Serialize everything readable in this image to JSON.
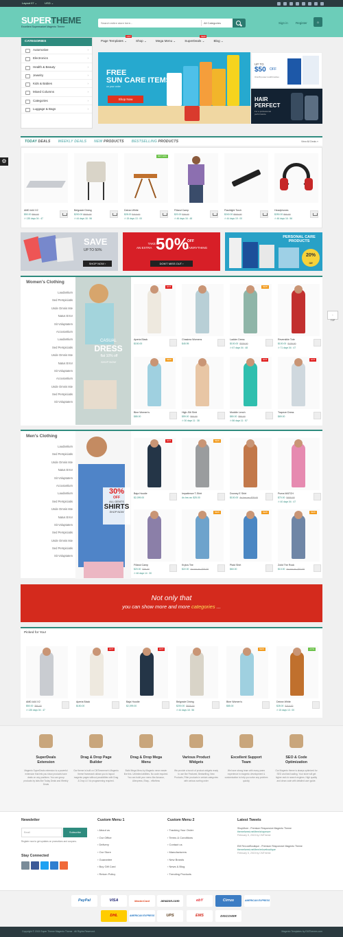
{
  "topbar": {
    "layout": "Layout 07 ⌄",
    "currency": "USD ⌄"
  },
  "header": {
    "logo_a": "SUPER",
    "logo_b": "THEME",
    "tagline": "Excellent Supermarket Magento Theme",
    "search_placeholder": "Search entire store here...",
    "search_category": "All Categories",
    "signin": "Sign in",
    "register": "Register",
    "cart_count": "0"
  },
  "categories": {
    "title": "CATEGORIES",
    "items": [
      "Automotive",
      "Electronics",
      "Health & Beauty",
      "Jewelry",
      "Kids & Babies",
      "Mixed Columns",
      "Categories",
      "Luggage & Bags"
    ]
  },
  "menu": {
    "items": [
      "Page Templates",
      "Shop",
      "Mega Menu",
      "SuperDeals",
      "Blog"
    ],
    "hot": "HOT",
    "new": "NEW"
  },
  "banner": {
    "title_line1": "FREE",
    "title_line2": "SUN CARE ITEMS",
    "sub": "on your order",
    "button": "Shop Now",
    "side1_a": "UP TO",
    "side1_b": "$50",
    "side1_c": "OFF",
    "side1_d": "Oral-B power toothbrushes",
    "side2_a": "HAIR",
    "side2_b": "PERFECT",
    "side2_c": "For a professional performance"
  },
  "tabs": {
    "t1a": "TODAY",
    "t1b": "DEALS",
    "t2": "WEEKLY DEALS",
    "t3a": "NEW",
    "t3b": "PRODUCTS",
    "t4a": "BESTSELLING",
    "t4b": "PRODUCTS",
    "view_all": "View All Deals »"
  },
  "deals": [
    {
      "name": "AMD A44 X2",
      "price": "$50.00",
      "old": "$90.00",
      "time": "135 days 04 : 47",
      "badge": ""
    },
    {
      "name": "Belgrade Dining",
      "price": "$200.00",
      "old": "$930.00",
      "time": "44 days 18 : 56",
      "badge": ""
    },
    {
      "name": "Deiran White",
      "price": "$28.00",
      "old": "$110.00",
      "time": "15 days 13 : 00",
      "badge": "SKY 10%"
    },
    {
      "name": "Filland Camp",
      "price": "$20.00",
      "old": "$26.00",
      "time": "46 days 16 : 48",
      "badge": ""
    },
    {
      "name": "Flashlight Torch",
      "price": "$240.00",
      "old": "$500.00",
      "time": "44 days 19 : 00",
      "badge": ""
    },
    {
      "name": "Headphones",
      "price": "$250.00",
      "old": "$60.00",
      "time": "46 days 16 : 56",
      "badge": ""
    }
  ],
  "promos": {
    "p1a": "SAVE",
    "p1b": "UP TO 50%",
    "p1c": "SHOP NOW ›",
    "p2a": "TAKE",
    "p2b": "AN EXTRA",
    "p2c": "50%",
    "p2d": "OFF",
    "p2e": "EVERYTHING",
    "p2f": "DON'T MISS OUT ›",
    "p3a": "PERSONAL CARE",
    "p3b": "PRODUCTS",
    "p3c": "20%",
    "p3d": "Off"
  },
  "women": {
    "title": "Women's Clothing",
    "sub": [
      "Laudantium",
      "Sed Perspiciatis",
      "Unde Omnis Iste",
      "Natus Error",
      "Sit Voluptatem",
      "Accusantium",
      "Laudantium",
      "Sed Perspiciatis",
      "Unde Omnis Iste",
      "Natus Error",
      "Sit Voluptatem",
      "Accusantium",
      "Unde Omnis Iste",
      "Sed Perspiciatis",
      "Sit Voluptatem"
    ],
    "promo_a": "CASUAL",
    "promo_b": "DRESS",
    "promo_c": "flat 10% off",
    "promo_d": "SHOP NOW",
    "items": [
      {
        "name": "Aperia Black",
        "price": "$150.00",
        "time": "",
        "badge": "HOT"
      },
      {
        "name": "Chasima Womens",
        "price": "$45.95",
        "time": "",
        "badge": ""
      },
      {
        "name": "Ladder Dress",
        "price": "$100.00",
        "old": "$330.00",
        "time": "67 days 04 : 48",
        "badge": "NEW"
      },
      {
        "name": "Reversible Tote",
        "price": "$100.00",
        "old": "$130.00",
        "time": "71 days 04 : 47",
        "badge": ""
      },
      {
        "name": "Bine Women's",
        "price": "$85.00",
        "time": "",
        "badge": "NEW"
      },
      {
        "name": "High-Slit Shirt",
        "price": "$59.00",
        "old": "$60.00",
        "time": "30 days 11 : 38",
        "badge": ""
      },
      {
        "name": "Moddle Lench",
        "price": "$80.00",
        "old": "$90.00",
        "time": "86 days 11 : 57",
        "badge": "HOT"
      },
      {
        "name": "Trapeze Dress",
        "price": "$69.00",
        "time": "",
        "badge": "HOT"
      }
    ]
  },
  "men": {
    "title": "Men's Clothing",
    "sub": [
      "Laudantium",
      "Sed Perspiciatis",
      "Unde Omnis Iste",
      "Natus Error",
      "Sit Voluptatem",
      "Accusantium",
      "Laudantium",
      "Sed Perspiciatis",
      "Unde Omnis Iste",
      "Natus Error",
      "Sit Voluptatem",
      "Sed Perspiciatis",
      "Unde Omnis Iste",
      "Sed Perspiciatis",
      "Sit Voluptatem"
    ],
    "promo_a": "30%",
    "promo_b": "OFF",
    "promo_c": "ALL GENTS",
    "promo_d": "SHIRTS",
    "promo_e": "SHOP NOW",
    "items": [
      {
        "name": "Baja Hoodie",
        "price": "$2,099.00",
        "time": "",
        "badge": "HOT"
      },
      {
        "name": "Impatience T-Shirt",
        "price": "As low as: $25.00",
        "time": "",
        "badge": "NEW"
      },
      {
        "name": "Dooney E Shirt",
        "price": "$100.00",
        "old": "As low as: $25.00",
        "time": "",
        "badge": ""
      },
      {
        "name": "Puma MATCH",
        "price": "$70.00",
        "old": "$400.00",
        "time": "40 days 04 : 47",
        "badge": ""
      },
      {
        "name": "Filland Camp",
        "price": "$20.00",
        "old": "$26.00",
        "time": "46 days 14 : 30",
        "badge": ""
      },
      {
        "name": "Krylos Tee",
        "price": "$22.00",
        "old": "As low as: $18.00",
        "time": "",
        "badge": "NEW"
      },
      {
        "name": "Plaid Shirt",
        "price": "$60.00",
        "time": "",
        "badge": "NEW"
      },
      {
        "name": "Zolid The Rock",
        "price": "$13.00",
        "old": "As low as: $10.00",
        "time": "",
        "badge": "NEW"
      }
    ]
  },
  "redbanner": {
    "line1": "Not only that",
    "line2a": "you can show more and more ",
    "line2b": "categories",
    "line2c": " ..."
  },
  "picked": {
    "title": "Picked for You!",
    "items": [
      {
        "name": "AMD A44 X2",
        "price": "$50.00",
        "old": "$90.00",
        "time": "135 days 04 : 47",
        "badge": ""
      },
      {
        "name": "Aperia Black",
        "price": "$150.00",
        "time": "",
        "badge": "HOT"
      },
      {
        "name": "Baja Hoodie",
        "price": "$2,099.00",
        "time": "",
        "badge": "HOT"
      },
      {
        "name": "Belgrade Dining",
        "price": "$200.00",
        "old": "$930.00",
        "time": "44 days 18 : 56",
        "badge": ""
      },
      {
        "name": "Bine Women's",
        "price": "$85.00",
        "time": "",
        "badge": "NEW"
      },
      {
        "name": "Deiran White",
        "price": "$28.00",
        "old": "$110.00",
        "time": "15 days 13 : 00",
        "badge": "-17%"
      }
    ]
  },
  "features": [
    {
      "t1": "SuperDeals",
      "t2": "Extension",
      "desc": "Magento SuperDeals extension is a powerful extension that lets you show products have deals on any positions. You can group products by tabs like Today Deals and Weekly Deals"
    },
    {
      "t1": "Drag & Drop Page",
      "t2": "Builder",
      "desc": "Our theme is built on CMTommerce's Magento theme framework allows you to layout magento pages without possibilities with Drag & Drop UI. No programming required."
    },
    {
      "t1": "Drag & Drop Mega",
      "t2": "Menu",
      "desc": "Build Mega Menu by Magento never easier like this. Unlimited abilities. No code required. You can build your menu like Amazon, Aliexpress, Ebay... effortless"
    },
    {
      "t1": "Various Product",
      "t2": "Widgets",
      "desc": "We provide a bunch of product widgets ready to use like Featured, Bestselling, New Products, Filter products in certain categories with various sorting order"
    },
    {
      "t1": "Excellent Support",
      "t2": "Team",
      "desc": "We have strong team with many years experience in magento development & customization to help you solve any problem quickly"
    },
    {
      "t1": "SEO & Code",
      "t2": "Optimization",
      "desc": "Our Magento theme is always optimized for SEO and fast loading. Your store will get higher rank in search engines. High quality and clean code with detailed user guide."
    }
  ],
  "footer": {
    "newsletter": "Newsletter",
    "nl_placeholder": "Email",
    "nl_button": "Subscribe",
    "nl_text": "Register now to get updates on promotions and coupons.",
    "stay": "Stay Connected",
    "menu1": "Custom Menu 1",
    "menu1_items": [
      "About us",
      "Our Office",
      "Delivery",
      "Our Store",
      "Guarantee",
      "Buy Gift Card",
      "Return Policy"
    ],
    "menu2": "Custom Menu 2",
    "menu2_items": [
      "Tracking Your Order",
      "Terms & Conditions",
      "Contact us",
      "Manufacturers",
      "New Brands",
      "News & Blog",
      "Trending Products"
    ],
    "tweets": "Latest Tweets",
    "tw1a": "ShopMore - Premium Responsive Magento Theme",
    "tw1b": "themeforest.net/item/shopmore",
    "tw1c": "February 5, 2015  by CMTheme",
    "tw2a": "EM ReLoveBoutique - Premium Responsive Magento Theme",
    "tw2b": "themeforest.net/item/reloveboutique",
    "tw2c": "February 5, 2015  by CMTheme"
  },
  "payments": [
    "PayPal",
    "VISA",
    "MasterCard",
    "amazon.com",
    "ebY",
    "Cirrus",
    "AMERICAN EXPRESS",
    "DHL",
    "AMERICAN EXPRESS",
    "UPS",
    "EMS",
    "DISCOVER"
  ],
  "copyright": "Copyright © 2015 Super Theme Magento Theme . All Rights Reserved.",
  "designed": "Magento Templates by EMThemes.com",
  "top_btn": "TOP",
  "colors": {
    "accent": "#2e8b7e",
    "header": "#6ccdb9",
    "hot": "#e02020",
    "new": "#f29b1d"
  }
}
